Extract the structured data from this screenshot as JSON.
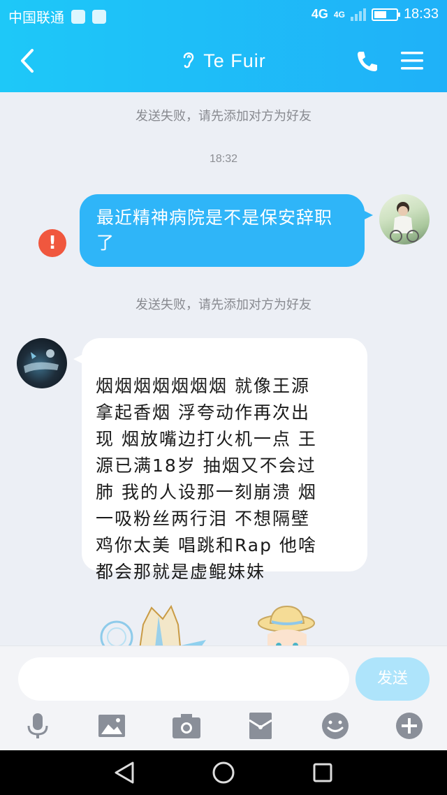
{
  "status_bar": {
    "carrier": "中国联通",
    "network": "4G",
    "network_secondary": "4G",
    "time": "18:33",
    "battery_level": 0.55
  },
  "header": {
    "title": "Te Fuir",
    "icons": [
      "back-icon",
      "ear-icon",
      "phone-icon",
      "menu-icon"
    ]
  },
  "chat": {
    "system_note_1": "发送失败，请先添加对方为好友",
    "timestamp": "18:32",
    "outgoing_message": "最近精神病院是不是保安辞职了",
    "error_mark": "!",
    "system_note_2": "发送失败，请先添加对方为好友",
    "incoming_message": "烟烟烟烟烟烟烟 就像王源\n拿起香烟 浮夸动作再次出\n现 烟放嘴边打火机一点  王\n源已满18岁 抽烟又不会过\n肺  我的人设那一刻崩溃 烟\n一吸粉丝两行泪 不想隔壁\n鸡你太美 唱跳和Rap 他啥\n都会那就是虚鲲妹妹"
  },
  "input": {
    "value": "",
    "placeholder": "",
    "send_label": "发送"
  },
  "toolbar": {
    "items": [
      "microphone-icon",
      "image-icon",
      "camera-icon",
      "red-packet-icon",
      "emoji-icon",
      "plus-icon"
    ]
  },
  "colors": {
    "header": "#1fb8f8",
    "outgoing_bubble": "#2fb5f8",
    "error": "#f0573e",
    "send_button": "#aee4fb",
    "icon_gray": "#8a8f99"
  }
}
